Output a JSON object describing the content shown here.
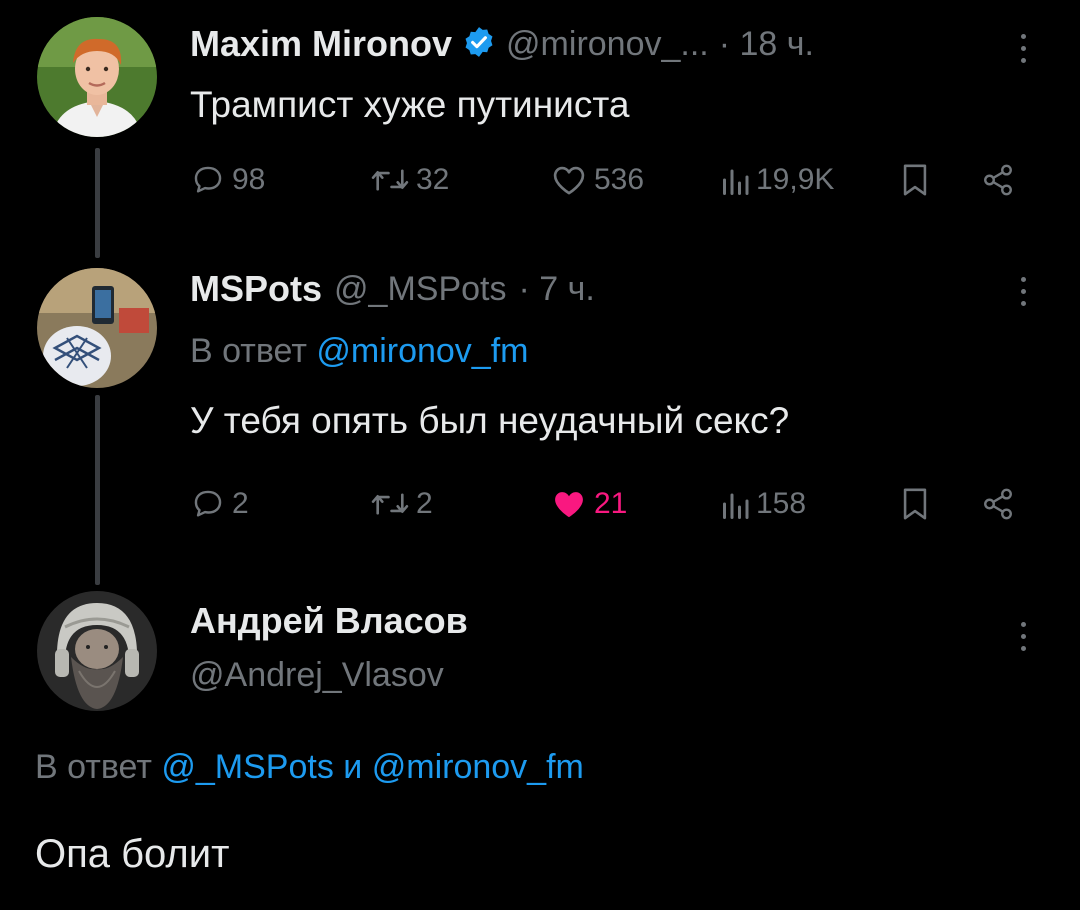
{
  "colors": {
    "background": "#000000",
    "text": "#e7e9ea",
    "muted": "#71767b",
    "link": "#1d9bf0",
    "like_active": "#f91880",
    "thread_line": "#3a3d41"
  },
  "tweets": [
    {
      "author_name": "Maxim Mironov",
      "verified": true,
      "handle": "@mironov_...",
      "time": "· 18 ч.",
      "text": "Трампист хуже путиниста",
      "replies": "98",
      "retweets": "32",
      "likes": "536",
      "views": "19,9K",
      "liked": false
    },
    {
      "author_name": "MSPots",
      "handle": "@_MSPots",
      "time": "· 7 ч.",
      "reply_prefix": "В ответ",
      "reply_to": "@mironov_fm",
      "text": "У тебя опять был неудачный секс?",
      "replies": "2",
      "retweets": "2",
      "likes": "21",
      "views": "158",
      "liked": true
    },
    {
      "author_name": "Андрей Власов",
      "handle": "@Andrej_Vlasov",
      "reply_prefix": "В ответ",
      "reply_to_1": "@_MSPots",
      "reply_conj": "и",
      "reply_to_2": "@mironov_fm",
      "text": "Опа болит"
    }
  ],
  "icons": {
    "reply": "speech-bubble-icon",
    "retweet": "retweet-icon",
    "like": "heart-icon",
    "views": "bar-chart-icon",
    "bookmark": "bookmark-icon",
    "share": "share-icon",
    "more": "vertical-dots-icon",
    "verified": "verified-badge-icon"
  }
}
